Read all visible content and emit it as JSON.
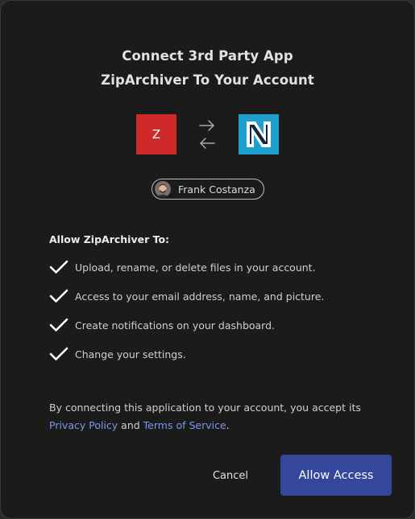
{
  "dialog": {
    "title_line1": "Connect 3rd Party App",
    "title_line2": "ZipArchiver To Your Account"
  },
  "apps": {
    "source_logo_text": "Z",
    "source_color": "#cf2a2a",
    "target_logo_icon": "n-letter-logo",
    "target_color": "#1ea0cf",
    "exchange_icon": "swap-arrows-icon"
  },
  "user": {
    "name": "Frank Costanza",
    "avatar_icon": "user-avatar"
  },
  "permissions": {
    "heading": "Allow ZipArchiver To:",
    "items": [
      "Upload, rename, or delete files in your account.",
      "Access to your email address, name, and picture.",
      "Create notifications on your dashboard.",
      "Change your settings."
    ],
    "check_icon": "checkmark-icon"
  },
  "legal": {
    "text_before": "By connecting this application to your account, you accept its",
    "privacy_link": "Privacy Policy",
    "connector": " and ",
    "terms_link": "Terms of Service",
    "text_after": ".",
    "link_color": "#7f97e8"
  },
  "actions": {
    "cancel_label": "Cancel",
    "allow_label": "Allow Access",
    "allow_color": "#34479b"
  }
}
